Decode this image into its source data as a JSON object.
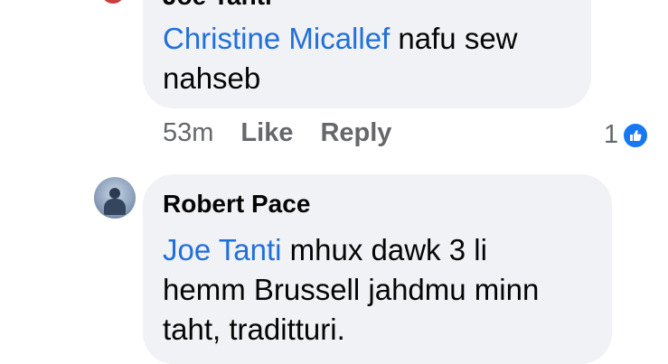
{
  "comment1": {
    "author_partial": "Joe Tanti",
    "mention": "Christine Micallef",
    "text_line1": " nafu sew",
    "text_line2": "nahseb",
    "time": "53m",
    "like_label": "Like",
    "reply_label": "Reply",
    "reaction_count": "1",
    "reaction_icon": "thumbs-up-icon"
  },
  "comment2": {
    "author": "Robert Pace",
    "mention": "Joe Tanti",
    "text_line1": " mhux dawk 3 li",
    "text_line2": "hemm Brussell jahdmu minn",
    "text_line3": "taht, traditturi."
  },
  "colors": {
    "mention": "#216fdb",
    "bubble": "#f0f2f5",
    "meta": "#65676b",
    "like_badge": "#1877f2"
  }
}
